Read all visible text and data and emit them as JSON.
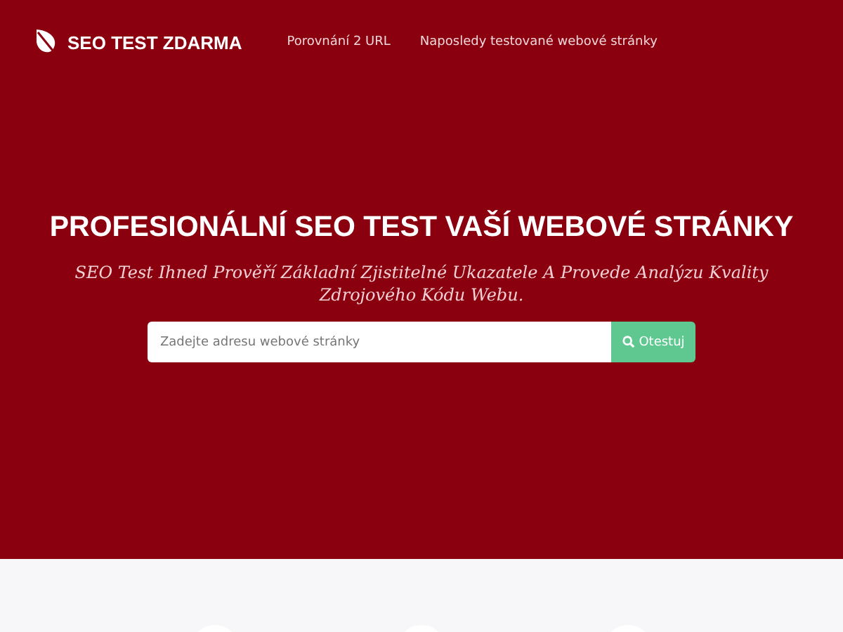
{
  "brand": {
    "name": "SEO TEST ZDARMA"
  },
  "nav": [
    {
      "label": "Porovnání 2 URL"
    },
    {
      "label": "Naposledy testované webové stránky"
    }
  ],
  "hero": {
    "title": "PROFESIONÁLNÍ SEO TEST VAŠÍ WEBOVÉ STRÁNKY",
    "subtitle": "SEO Test Ihned Prověří Základní Zjistitelné Ukazatele A Provede Analýzu Kvality Zdrojového Kódu Webu."
  },
  "search": {
    "placeholder": "Zadejte adresu webové stránky",
    "button": "Otestuj"
  },
  "features": [
    {
      "kind": "circle"
    },
    {
      "kind": "circle"
    },
    {
      "kind": "circle"
    }
  ]
}
